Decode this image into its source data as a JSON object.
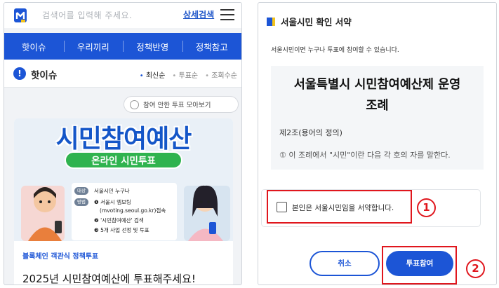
{
  "left": {
    "search_placeholder": "검색어를 입력해 주세요.",
    "advanced_search": "상세검색",
    "nav": [
      "핫이슈",
      "우리끼리",
      "정책반영",
      "정책참고"
    ],
    "section_title": "핫이슈",
    "sorts": [
      "최신순",
      "투표순",
      "조회수순"
    ],
    "filter_label": "참여 안한 투표 모아보기",
    "banner": {
      "title": "시민참여예산",
      "pill": "온라인 시민투표",
      "tag_target": "대상",
      "tag_method": "방법",
      "target": "서울시민 누구나",
      "method_1": "❶ 서울시 엠보팅",
      "method_1b": "(mvoting.seoul.go.kr)접속",
      "method_2": "❷ '시민참여예산' 검색",
      "method_3": "❸ 5개 사업 선정 및 투표"
    },
    "card_subtitle": "블록체인 객관식 정책투표",
    "card_title": "2025년 시민참여예산에 투표해주세요!"
  },
  "right": {
    "modal_title": "서울시민 확인 서약",
    "modal_desc": "서울시민이면 누구나 투표에 참여할 수 있습니다.",
    "terms_title_1": "서울특별시 시민참여예산제 운영",
    "terms_title_2": "조례",
    "terms_article": "제2조(용어의 정의)",
    "terms_body": "① 이 조례에서 \"시민\"이란 다음 각 호의 자를 말한다.",
    "consent_label": "본인은 서울시민임을 서약합니다.",
    "marker_1": "1",
    "cancel": "취소",
    "vote": "투표참여",
    "marker_2": "2"
  },
  "colors": {
    "brand_blue": "#1c55d6",
    "highlight_red": "#e0161d",
    "pill_green": "#2fb34f",
    "logo_yellow": "#f3c31c"
  }
}
